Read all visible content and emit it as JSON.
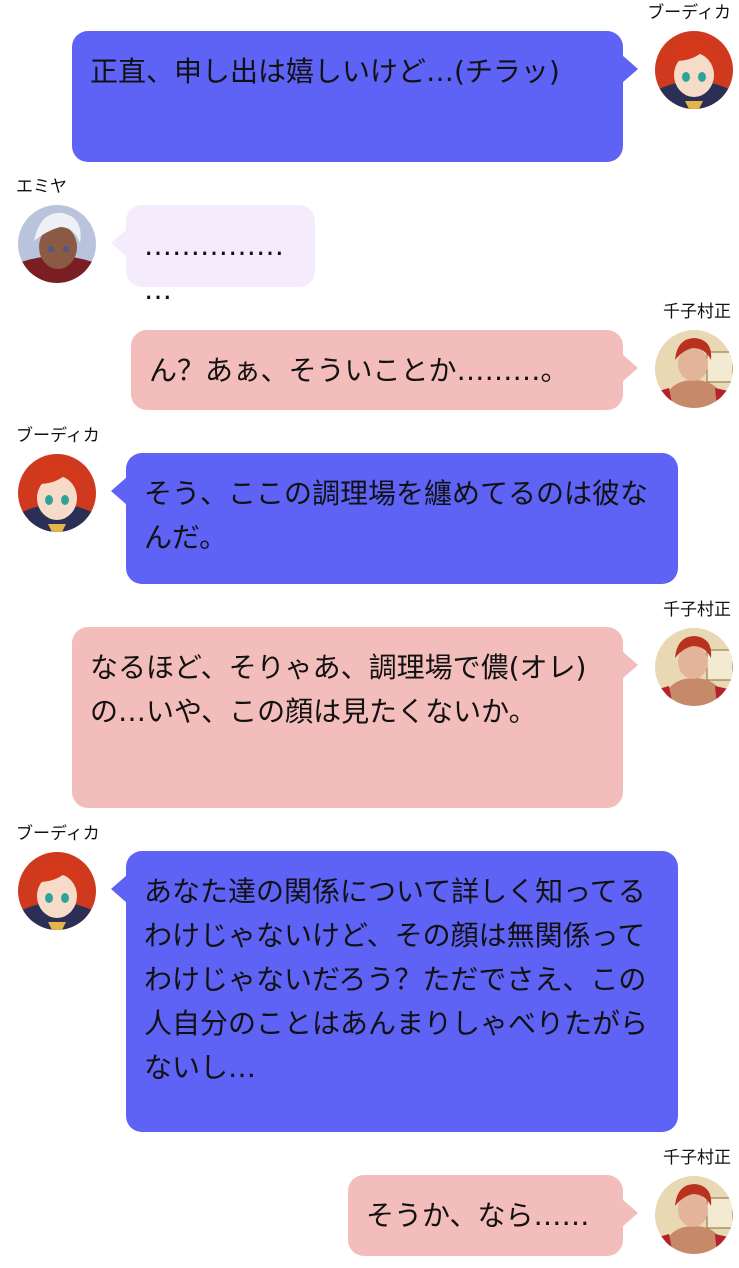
{
  "colors": {
    "boudica_bubble": "#5e62f5",
    "muramasa_bubble": "#f3bdbb",
    "emiya_bubble": "#f4ebfc",
    "background": "#ffffff"
  },
  "messages": [
    {
      "speaker": "ブーディカ",
      "side": "right",
      "text": "正直、申し出は嬉しいけど…(チラッ)"
    },
    {
      "speaker": "エミヤ",
      "side": "left",
      "text": "………………"
    },
    {
      "speaker": "千子村正",
      "side": "right",
      "text": "ん？あぁ、そういことか………。"
    },
    {
      "speaker": "ブーディカ",
      "side": "left",
      "text": "そう、ここの調理場を纏めてるのは彼なんだ。"
    },
    {
      "speaker": "千子村正",
      "side": "right",
      "text": "なるほど、そりゃあ、調理場で儂(オレ)の…いや、この顔は見たくないか。"
    },
    {
      "speaker": "ブーディカ",
      "side": "left",
      "text": "あなた達の関係について詳しく知ってるわけじゃないけど、その顔は無関係ってわけじゃないだろう？ただでさえ、この人自分のことはあんまりしゃべりたがらないし…"
    },
    {
      "speaker": "千子村正",
      "side": "right",
      "text": "そうか、なら……"
    }
  ]
}
